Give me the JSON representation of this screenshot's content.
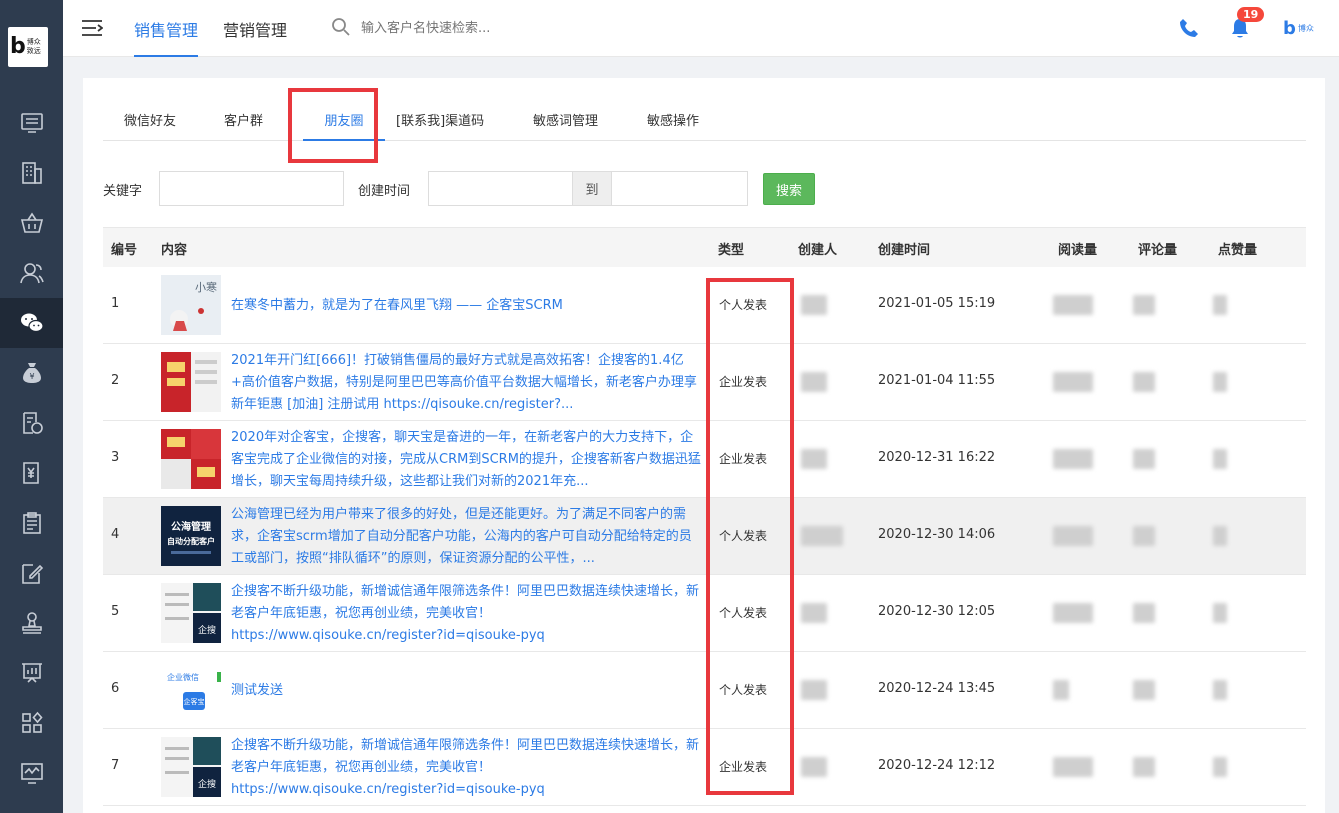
{
  "logo": {
    "letter": "b",
    "text_line1": "博众",
    "text_line2": "致远"
  },
  "header": {
    "nav": [
      {
        "label": "销售管理"
      },
      {
        "label": "营销管理"
      }
    ],
    "search_placeholder": "输入客户名快速检索...",
    "notification_count": "19",
    "brand_letter": "b",
    "brand_text": "博众"
  },
  "sidebar": {
    "icons": [
      "monitor-icon",
      "building-icon",
      "basket-icon",
      "users-icon",
      "wechat-icon",
      "money-bag-icon",
      "document-icon",
      "finance-icon",
      "clipboard-icon",
      "edit-icon",
      "stamp-icon",
      "chart-icon",
      "apps-icon",
      "analytics-icon"
    ],
    "active_index": 4
  },
  "tabs": [
    {
      "label": "微信好友"
    },
    {
      "label": "客户群"
    },
    {
      "label": "朋友圈"
    },
    {
      "label": "[联系我]渠道码"
    },
    {
      "label": "敏感词管理"
    },
    {
      "label": "敏感操作"
    }
  ],
  "filter": {
    "keyword_label": "关键字",
    "created_label": "创建时间",
    "to_label": "到",
    "search_button": "搜索"
  },
  "table": {
    "headers": [
      "编号",
      "内容",
      "类型",
      "创建人",
      "创建时间",
      "阅读量",
      "评论量",
      "点赞量"
    ],
    "rows": [
      {
        "no": "1",
        "content": "在寒冬中蓄力，就是为了在春风里飞翔 —— 企客宝SCRM",
        "type": "个人发表",
        "time": "2021-01-05 15:19"
      },
      {
        "no": "2",
        "content": "2021年开门红[666]！打破销售僵局的最好方式就是高效拓客！企搜客的1.4亿+高价值客户数据，特别是阿里巴巴等高价值平台数据大幅增长，新老客户办理享新年钜惠 [加油] 注册试用 https://qisouke.cn/register?...",
        "type": "企业发表",
        "time": "2021-01-04 11:55"
      },
      {
        "no": "3",
        "content": "2020年对企客宝，企搜客，聊天宝是奋进的一年，在新老客户的大力支持下，企客宝完成了企业微信的对接，完成从CRM到SCRM的提升，企搜客新客户数据迅猛增长，聊天宝每周持续升级，这些都让我们对新的2021年充...",
        "type": "企业发表",
        "time": "2020-12-31 16:22"
      },
      {
        "no": "4",
        "content": "公海管理已经为用户带来了很多的好处，但是还能更好。为了满足不同客户的需求，企客宝scrm增加了自动分配客户功能，公海内的客户可自动分配给特定的员工或部门，按照“排队循环”的原则，保证资源分配的公平性，...",
        "type": "个人发表",
        "time": "2020-12-30 14:06"
      },
      {
        "no": "5",
        "content": "企搜客不断升级功能，新增诚信通年限筛选条件！阿里巴巴数据连续快速增长，新老客户年底钜惠，祝您再创业绩，完美收官！ https://www.qisouke.cn/register?id=qisouke-pyq",
        "type": "个人发表",
        "time": "2020-12-30 12:05"
      },
      {
        "no": "6",
        "content": "测试发送",
        "type": "个人发表",
        "time": "2020-12-24 13:45"
      },
      {
        "no": "7",
        "content": "企搜客不断升级功能，新增诚信通年限筛选条件！阿里巴巴数据连续快速增长，新老客户年底钜惠，祝您再创业绩，完美收官！ https://www.qisouke.cn/register?id=qisouke-pyq",
        "type": "企业发表",
        "time": "2020-12-24 12:12"
      }
    ],
    "hover_row": 3
  },
  "thumb_texts": {
    "r1": "小寒",
    "r4_line1": "公海管理",
    "r4_line2": "自动分配客户",
    "r5": "企搜",
    "r6_line1": "企业微信",
    "r6_line2": "企客宝"
  },
  "colors": {
    "accent": "#2c7be5",
    "highlight": "#e8383d",
    "sidebar": "#2e3c4f",
    "search_button": "#5cb85c",
    "badge": "#f5483b"
  }
}
